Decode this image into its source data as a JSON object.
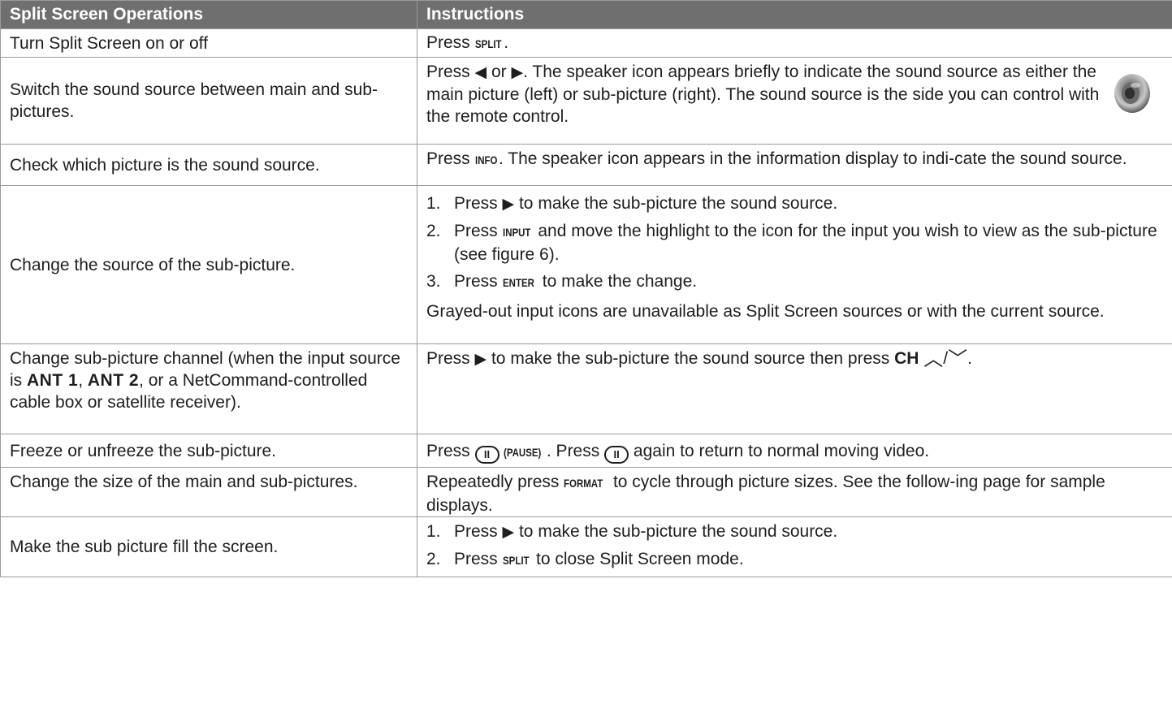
{
  "table": {
    "header": {
      "col1": "Split Screen Operations",
      "col2": "Instructions"
    },
    "rows": {
      "split": {
        "op": "Turn Split Screen on or off",
        "press": "Press ",
        "key": "SPLIT",
        "end": "."
      },
      "switch": {
        "op": "Switch the sound source between main and sub-pictures.",
        "press": "Press ",
        "left_arrow": "◀",
        "or": " or ",
        "right_arrow": "▶",
        "rest": ".  The speaker icon appears briefly to indicate the sound source as either the main picture (left) or sub-picture (right).  The sound source is the side you can control with the remote control.",
        "icon": "speaker-icon"
      },
      "check": {
        "op": "Check which picture is the sound source.",
        "press": "Press ",
        "key": "INFO",
        "rest": ".  The speaker icon appears in the information display to indi-cate the sound source."
      },
      "change_source": {
        "op": "Change the source of the sub-picture.",
        "steps": [
          {
            "num": "1.",
            "press": "Press ",
            "arrow": "▶",
            "rest": " to make the sub-picture the sound source."
          },
          {
            "num": "2.",
            "press": "Press ",
            "key": "INPUT",
            "rest": " and move the highlight to the icon for the input you wish to view as the sub-picture (see figure 6)."
          },
          {
            "num": "3.",
            "press": "Press ",
            "key": "ENTER",
            "rest": " to make the change."
          }
        ],
        "note": "Grayed-out input icons are unavailable as Split Screen sources or with the current source."
      },
      "channel": {
        "op_a": "Change sub-picture channel (when the input source is ",
        "ant1": "ANT 1",
        "comma": ", ",
        "ant2": "ANT 2",
        "op_b": ", or a NetCommand-controlled cable box or satellite receiver).",
        "press": "Press ",
        "arrow": "▶",
        "rest": " to make the sub-picture the sound source then press ",
        "ch": "CH",
        "up": "︿",
        "slash": "/",
        "down": "﹀",
        "end": "."
      },
      "freeze": {
        "op": "Freeze or unfreeze the sub-picture.",
        "press": "Press ",
        "btn": "II",
        "key": "(PAUSE)",
        "mid": ".  Press ",
        "rest": " again to return to normal moving video."
      },
      "size": {
        "op": "Change the size of the main and sub-pictures.",
        "pre": "Repeatedly press ",
        "key": "FORMAT",
        "rest": " to cycle through picture sizes.  See the follow-ing page for sample displays."
      },
      "fill": {
        "op": "Make the sub picture fill the screen.",
        "steps": [
          {
            "num": "1.",
            "press": "Press ",
            "arrow": "▶",
            "rest": " to make the sub-picture the sound source."
          },
          {
            "num": "2.",
            "press": "Press ",
            "key": "SPLIT",
            "rest": " to close Split Screen mode."
          }
        ]
      }
    }
  }
}
